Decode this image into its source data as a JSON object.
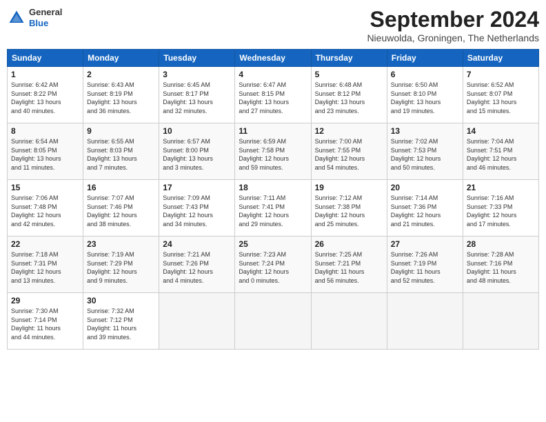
{
  "header": {
    "logo_line1": "General",
    "logo_line2": "Blue",
    "month": "September 2024",
    "location": "Nieuwolda, Groningen, The Netherlands"
  },
  "weekdays": [
    "Sunday",
    "Monday",
    "Tuesday",
    "Wednesday",
    "Thursday",
    "Friday",
    "Saturday"
  ],
  "weeks": [
    [
      {
        "day": "1",
        "info": "Sunrise: 6:42 AM\nSunset: 8:22 PM\nDaylight: 13 hours\nand 40 minutes."
      },
      {
        "day": "2",
        "info": "Sunrise: 6:43 AM\nSunset: 8:19 PM\nDaylight: 13 hours\nand 36 minutes."
      },
      {
        "day": "3",
        "info": "Sunrise: 6:45 AM\nSunset: 8:17 PM\nDaylight: 13 hours\nand 32 minutes."
      },
      {
        "day": "4",
        "info": "Sunrise: 6:47 AM\nSunset: 8:15 PM\nDaylight: 13 hours\nand 27 minutes."
      },
      {
        "day": "5",
        "info": "Sunrise: 6:48 AM\nSunset: 8:12 PM\nDaylight: 13 hours\nand 23 minutes."
      },
      {
        "day": "6",
        "info": "Sunrise: 6:50 AM\nSunset: 8:10 PM\nDaylight: 13 hours\nand 19 minutes."
      },
      {
        "day": "7",
        "info": "Sunrise: 6:52 AM\nSunset: 8:07 PM\nDaylight: 13 hours\nand 15 minutes."
      }
    ],
    [
      {
        "day": "8",
        "info": "Sunrise: 6:54 AM\nSunset: 8:05 PM\nDaylight: 13 hours\nand 11 minutes."
      },
      {
        "day": "9",
        "info": "Sunrise: 6:55 AM\nSunset: 8:03 PM\nDaylight: 13 hours\nand 7 minutes."
      },
      {
        "day": "10",
        "info": "Sunrise: 6:57 AM\nSunset: 8:00 PM\nDaylight: 13 hours\nand 3 minutes."
      },
      {
        "day": "11",
        "info": "Sunrise: 6:59 AM\nSunset: 7:58 PM\nDaylight: 12 hours\nand 59 minutes."
      },
      {
        "day": "12",
        "info": "Sunrise: 7:00 AM\nSunset: 7:55 PM\nDaylight: 12 hours\nand 54 minutes."
      },
      {
        "day": "13",
        "info": "Sunrise: 7:02 AM\nSunset: 7:53 PM\nDaylight: 12 hours\nand 50 minutes."
      },
      {
        "day": "14",
        "info": "Sunrise: 7:04 AM\nSunset: 7:51 PM\nDaylight: 12 hours\nand 46 minutes."
      }
    ],
    [
      {
        "day": "15",
        "info": "Sunrise: 7:06 AM\nSunset: 7:48 PM\nDaylight: 12 hours\nand 42 minutes."
      },
      {
        "day": "16",
        "info": "Sunrise: 7:07 AM\nSunset: 7:46 PM\nDaylight: 12 hours\nand 38 minutes."
      },
      {
        "day": "17",
        "info": "Sunrise: 7:09 AM\nSunset: 7:43 PM\nDaylight: 12 hours\nand 34 minutes."
      },
      {
        "day": "18",
        "info": "Sunrise: 7:11 AM\nSunset: 7:41 PM\nDaylight: 12 hours\nand 29 minutes."
      },
      {
        "day": "19",
        "info": "Sunrise: 7:12 AM\nSunset: 7:38 PM\nDaylight: 12 hours\nand 25 minutes."
      },
      {
        "day": "20",
        "info": "Sunrise: 7:14 AM\nSunset: 7:36 PM\nDaylight: 12 hours\nand 21 minutes."
      },
      {
        "day": "21",
        "info": "Sunrise: 7:16 AM\nSunset: 7:33 PM\nDaylight: 12 hours\nand 17 minutes."
      }
    ],
    [
      {
        "day": "22",
        "info": "Sunrise: 7:18 AM\nSunset: 7:31 PM\nDaylight: 12 hours\nand 13 minutes."
      },
      {
        "day": "23",
        "info": "Sunrise: 7:19 AM\nSunset: 7:29 PM\nDaylight: 12 hours\nand 9 minutes."
      },
      {
        "day": "24",
        "info": "Sunrise: 7:21 AM\nSunset: 7:26 PM\nDaylight: 12 hours\nand 4 minutes."
      },
      {
        "day": "25",
        "info": "Sunrise: 7:23 AM\nSunset: 7:24 PM\nDaylight: 12 hours\nand 0 minutes."
      },
      {
        "day": "26",
        "info": "Sunrise: 7:25 AM\nSunset: 7:21 PM\nDaylight: 11 hours\nand 56 minutes."
      },
      {
        "day": "27",
        "info": "Sunrise: 7:26 AM\nSunset: 7:19 PM\nDaylight: 11 hours\nand 52 minutes."
      },
      {
        "day": "28",
        "info": "Sunrise: 7:28 AM\nSunset: 7:16 PM\nDaylight: 11 hours\nand 48 minutes."
      }
    ],
    [
      {
        "day": "29",
        "info": "Sunrise: 7:30 AM\nSunset: 7:14 PM\nDaylight: 11 hours\nand 44 minutes."
      },
      {
        "day": "30",
        "info": "Sunrise: 7:32 AM\nSunset: 7:12 PM\nDaylight: 11 hours\nand 39 minutes."
      },
      {
        "day": "",
        "info": ""
      },
      {
        "day": "",
        "info": ""
      },
      {
        "day": "",
        "info": ""
      },
      {
        "day": "",
        "info": ""
      },
      {
        "day": "",
        "info": ""
      }
    ]
  ]
}
